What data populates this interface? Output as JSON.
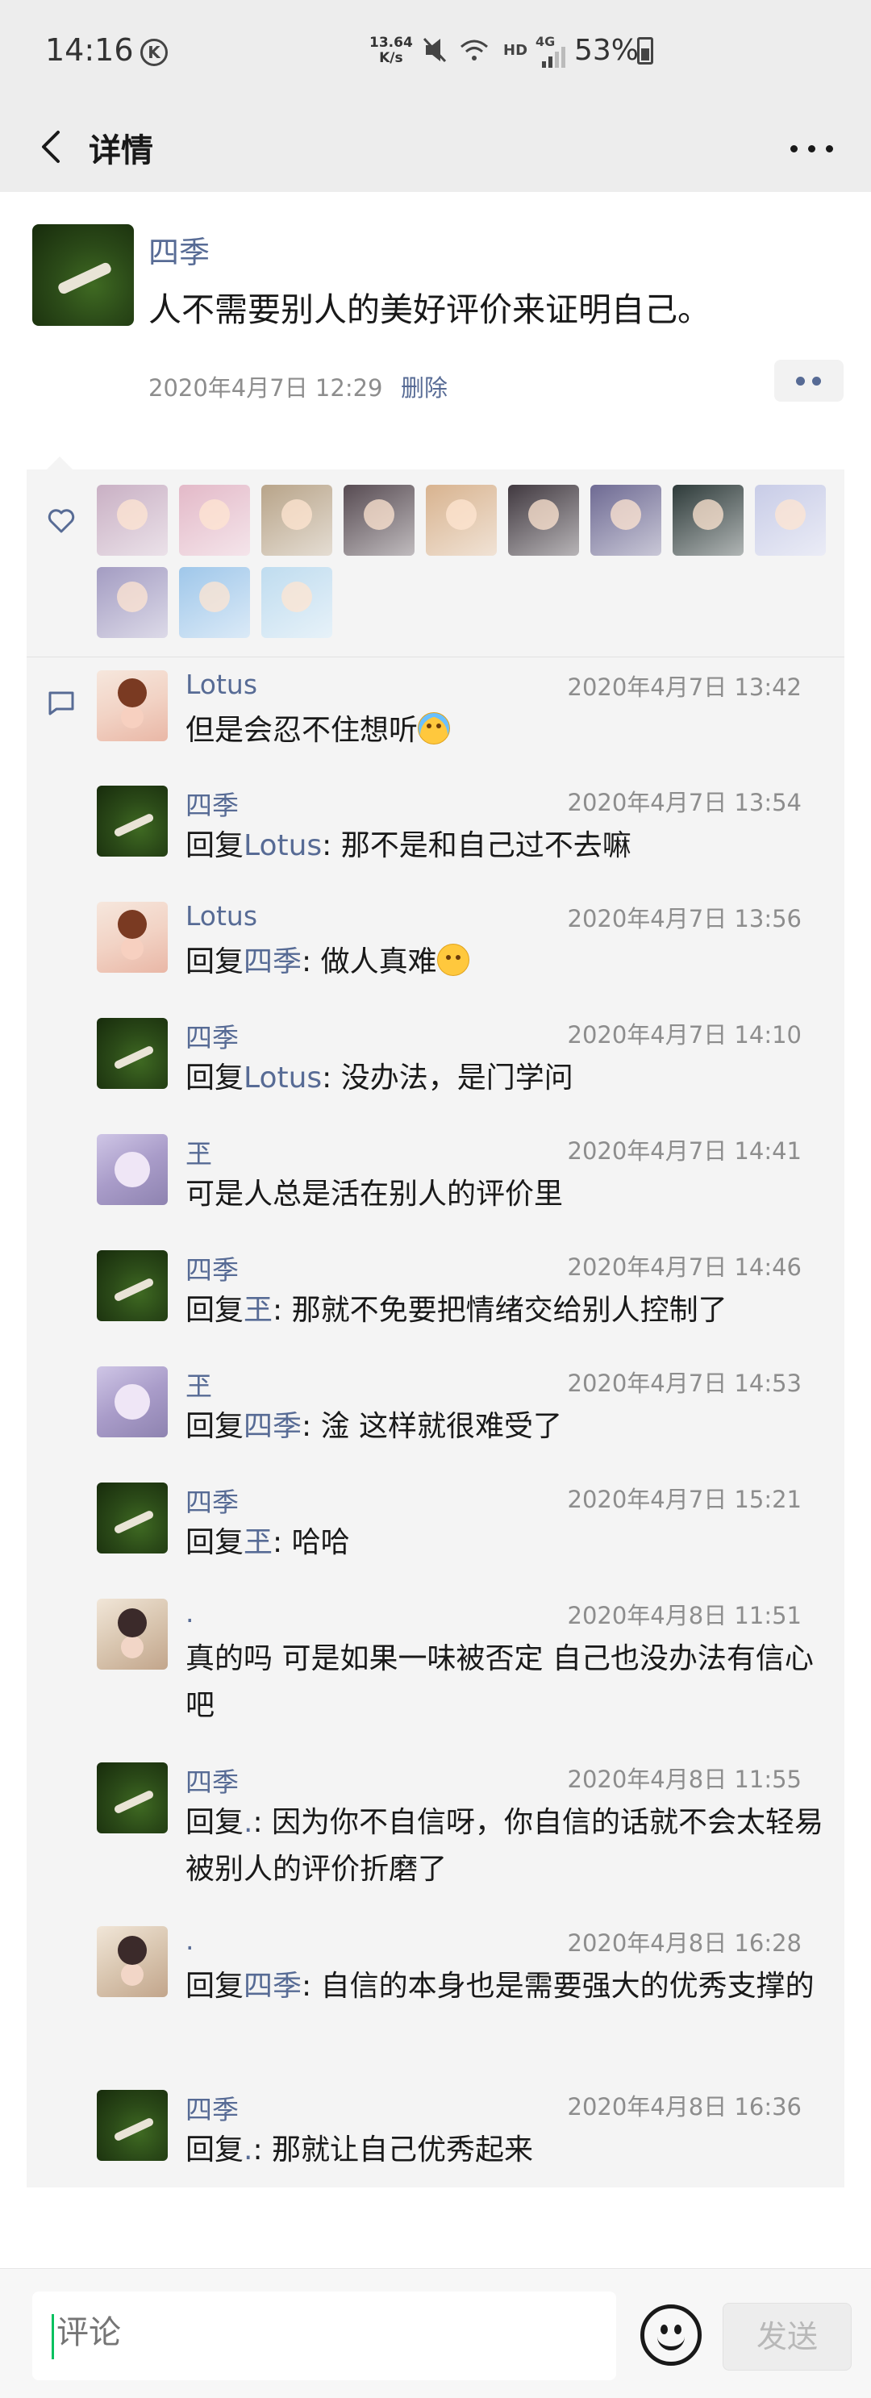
{
  "status_bar": {
    "time": "14:16",
    "k_badge": "K",
    "net_speed_value": "13.64",
    "net_speed_unit": "K/s",
    "hd": "HD",
    "signal": "4G",
    "battery": "53%"
  },
  "navbar": {
    "title": "详情",
    "back_icon": "chevron-left-icon",
    "more_icon": "more-dots-icon"
  },
  "post": {
    "author": "四季",
    "text": "人不需要别人的美好评价来证明自己。",
    "date": "2020年4月7日 12:29",
    "delete_label": "删除",
    "action_icon": "two-dots-icon"
  },
  "likes": {
    "icon": "heart-outline-icon",
    "avatar_colors": [
      "#c9b0c4",
      "#e3b9c8",
      "#b8a489",
      "#574b52",
      "#d8b38f",
      "#40383f",
      "#6e6a93",
      "#2d3a39",
      "#c8cce7",
      "#a39cc2",
      "#9fc7ea",
      "#bfdcef"
    ]
  },
  "comments_icon": "comment-bubble-icon",
  "comments": [
    {
      "name": "Lotus",
      "time": "2020年4月7日 13:42",
      "prefix": "",
      "reply_to": "",
      "sep": "",
      "text": "但是会忍不住想听",
      "emoji": "cry-emoji"
    },
    {
      "name": "四季",
      "time": "2020年4月7日 13:54",
      "prefix": "回复",
      "reply_to": "Lotus",
      "sep": ": ",
      "text": "那不是和自己过不去嘛",
      "emoji": ""
    },
    {
      "name": "Lotus",
      "time": "2020年4月7日 13:56",
      "prefix": "回复",
      "reply_to": "四季",
      "sep": ": ",
      "text": "做人真难",
      "emoji": "sad-emoji"
    },
    {
      "name": "四季",
      "time": "2020年4月7日 14:10",
      "prefix": "回复",
      "reply_to": "Lotus",
      "sep": ": ",
      "text": "没办法，是门学问",
      "emoji": ""
    },
    {
      "name": "玊",
      "time": "2020年4月7日 14:41",
      "prefix": "",
      "reply_to": "",
      "sep": "",
      "text": "可是人总是活在别人的评价里",
      "emoji": ""
    },
    {
      "name": "四季",
      "time": "2020年4月7日 14:46",
      "prefix": "回复",
      "reply_to": "玊",
      "sep": ": ",
      "text": "那就不免要把情绪交给别人控制了",
      "emoji": ""
    },
    {
      "name": "玊",
      "time": "2020年4月7日 14:53",
      "prefix": "回复",
      "reply_to": "四季",
      "sep": ": ",
      "text": "淦 这样就很难受了",
      "emoji": ""
    },
    {
      "name": "四季",
      "time": "2020年4月7日 15:21",
      "prefix": "回复",
      "reply_to": "玊",
      "sep": ": ",
      "text": "哈哈",
      "emoji": ""
    },
    {
      "name": ".",
      "time": "2020年4月8日 11:51",
      "prefix": "",
      "reply_to": "",
      "sep": "",
      "text": "真的吗 可是如果一味被否定 自己也没办法有信心吧",
      "emoji": ""
    },
    {
      "name": "四季",
      "time": "2020年4月8日 11:55",
      "prefix": "回复",
      "reply_to": ".",
      "sep": ": ",
      "text": "因为你不自信呀，你自信的话就不会太轻易被别人的评价折磨了",
      "emoji": ""
    },
    {
      "name": ".",
      "time": "2020年4月8日 16:28",
      "prefix": "回复",
      "reply_to": "四季",
      "sep": ": ",
      "text": "自信的本身也是需要强大的优秀支撑的",
      "emoji": ""
    },
    {
      "name": "四季",
      "time": "2020年4月8日 16:36",
      "prefix": "回复",
      "reply_to": ".",
      "sep": ": ",
      "text": "那就让自己优秀起来",
      "emoji": ""
    }
  ],
  "bottom": {
    "placeholder": "评论",
    "emoji_icon": "smiley-icon",
    "send_label": "发送"
  }
}
